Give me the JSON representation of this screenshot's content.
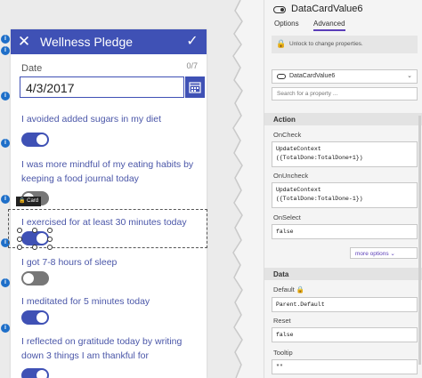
{
  "screen": {
    "header": {
      "title": "Wellness Pledge",
      "close_icon": "close-icon",
      "confirm_icon": "checkmark-icon",
      "color": "#3f51b5"
    },
    "date_card": {
      "label": "Date",
      "counter": "0/7",
      "value": "4/3/2017",
      "calendar_icon": "calendar-icon"
    },
    "pledges": [
      {
        "text": "I avoided added sugars in my diet",
        "on": true
      },
      {
        "text": "I was more mindful of my eating habits by keeping a food journal today",
        "on": false
      },
      {
        "text": "I exercised for at least 30 minutes today",
        "on": true,
        "selected": true
      },
      {
        "text": "I got 7-8 hours of sleep",
        "on": false
      },
      {
        "text": "I meditated for 5 minutes today",
        "on": true
      },
      {
        "text": "I reflected on gratitude today by writing down 3 things I am thankful for",
        "on": true
      }
    ],
    "selection_tag": "Card",
    "info_marker": "i"
  },
  "properties": {
    "control_name": "DataCardValue6",
    "tabs": [
      "Options",
      "Advanced"
    ],
    "active_tab": "Advanced",
    "lock_text": "Unlock to change properties.",
    "control_select": "DataCardValue6",
    "search_placeholder": "Search for a property ...",
    "action_section": "Action",
    "on_check_label": "OnCheck",
    "on_check_value": "UpdateContext\n({TotalDone:TotalDone+1})",
    "on_uncheck_label": "OnUncheck",
    "on_uncheck_value": "UpdateContext\n({TotalDone:TotalDone-1})",
    "on_select_label": "OnSelect",
    "on_select_value": "false",
    "more_options": "more options",
    "data_section": "Data",
    "default_label": "Default",
    "default_value": "Parent.Default",
    "reset_label": "Reset",
    "reset_value": "false",
    "tooltip_label": "Tooltip",
    "tooltip_value": "\"\""
  }
}
